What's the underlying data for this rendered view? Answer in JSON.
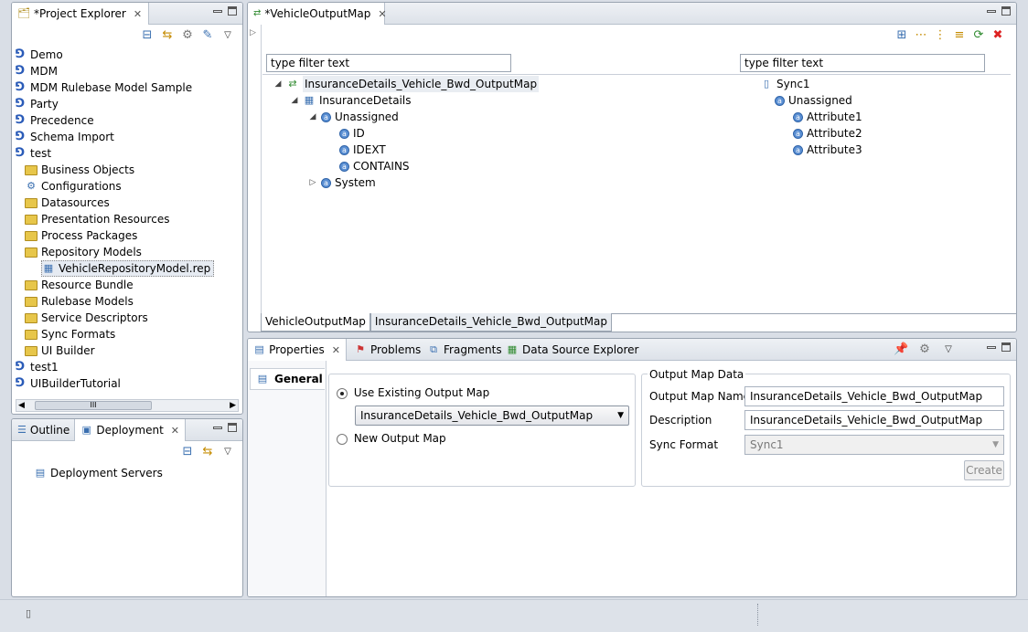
{
  "project_explorer": {
    "tab_label": "*Project Explorer",
    "items": [
      {
        "label": "Demo",
        "icon": "project-icon"
      },
      {
        "label": "MDM",
        "icon": "project-icon"
      },
      {
        "label": "MDM Rulebase Model Sample",
        "icon": "project-icon"
      },
      {
        "label": "Party",
        "icon": "project-icon"
      },
      {
        "label": "Precedence",
        "icon": "project-icon"
      },
      {
        "label": "Schema Import",
        "icon": "project-icon"
      },
      {
        "label": "test",
        "icon": "project-icon"
      },
      {
        "label": "Business Objects",
        "icon": "folder-icon"
      },
      {
        "label": "Configurations",
        "icon": "gear-icon"
      },
      {
        "label": "Datasources",
        "icon": "folder-icon"
      },
      {
        "label": "Presentation Resources",
        "icon": "folder-icon"
      },
      {
        "label": "Process Packages",
        "icon": "folder-icon"
      },
      {
        "label": "Repository Models",
        "icon": "folder-icon"
      },
      {
        "label": "VehicleRepositoryModel.rep",
        "icon": "file-icon"
      },
      {
        "label": "Resource Bundle",
        "icon": "folder-icon"
      },
      {
        "label": "Rulebase Models",
        "icon": "folder-icon"
      },
      {
        "label": "Service Descriptors",
        "icon": "folder-icon"
      },
      {
        "label": "Sync Formats",
        "icon": "folder-icon"
      },
      {
        "label": "UI Builder",
        "icon": "folder-icon"
      },
      {
        "label": "test1",
        "icon": "project-icon"
      },
      {
        "label": "UIBuilderTutorial",
        "icon": "project-icon"
      }
    ],
    "scroll_glyph": "III"
  },
  "outline": {
    "tab_outline": "Outline",
    "tab_deployment": "Deployment",
    "item": "Deployment Servers"
  },
  "editor": {
    "tab_label": "*VehicleOutputMap",
    "left_filter": "type filter text",
    "right_filter": "type filter text",
    "left_tree": [
      {
        "label": "InsuranceDetails_Vehicle_Bwd_OutputMap"
      },
      {
        "label": "InsuranceDetails"
      },
      {
        "label": "Unassigned"
      },
      {
        "label": "ID"
      },
      {
        "label": "IDEXT"
      },
      {
        "label": "CONTAINS"
      },
      {
        "label": "System"
      }
    ],
    "right_tree": [
      {
        "label": "Sync1"
      },
      {
        "label": "Unassigned"
      },
      {
        "label": "Attribute1"
      },
      {
        "label": "Attribute2"
      },
      {
        "label": "Attribute3"
      }
    ],
    "bottom_tabs": [
      "VehicleOutputMap",
      "InsuranceDetails_Vehicle_Bwd_OutputMap"
    ]
  },
  "properties": {
    "tabs": [
      "Properties",
      "Problems",
      "Fragments",
      "Data Source Explorer"
    ],
    "section": "General",
    "use_existing_label": "Use Existing Output Map",
    "existing_value": "InsuranceDetails_Vehicle_Bwd_OutputMap",
    "new_label": "New Output Map",
    "group_title": "Output Map Data",
    "name_label": "Output Map Name",
    "name_value": "InsuranceDetails_Vehicle_Bwd_OutputMap",
    "desc_label": "Description",
    "desc_value": "InsuranceDetails_Vehicle_Bwd_OutputMap",
    "sync_label": "Sync Format",
    "sync_value": "Sync1",
    "create_label": "Create"
  }
}
